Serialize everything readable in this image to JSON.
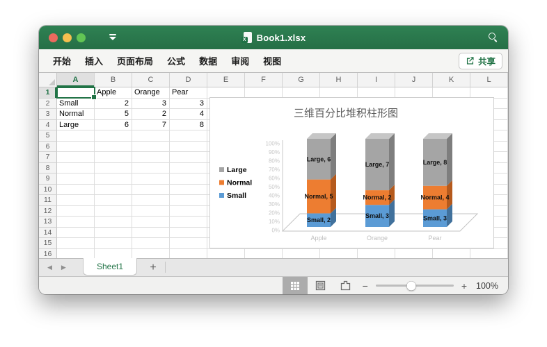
{
  "colors": {
    "accent_green": "#217346",
    "titlebar_green": "#2b7a4d",
    "series_small": "#5B9BD5",
    "series_normal": "#ED7D31",
    "series_large": "#A5A5A5"
  },
  "titlebar": {
    "title": "Book1.xlsx",
    "doc_badge": "X",
    "traffic_lights": [
      "close",
      "minimize",
      "zoom"
    ]
  },
  "menubar": {
    "items": [
      "开始",
      "插入",
      "页面布局",
      "公式",
      "数据",
      "审阅",
      "视图"
    ],
    "share_label": "共享"
  },
  "grid": {
    "column_headers": [
      "A",
      "B",
      "C",
      "D",
      "E",
      "F",
      "G",
      "H",
      "I",
      "J",
      "K",
      "L"
    ],
    "row_count": 16,
    "selected_cell": "A1",
    "selected_column": "A",
    "selected_row": "1",
    "cells": {
      "B1": "Apple",
      "C1": "Orange",
      "D1": "Pear",
      "A2": "Small",
      "B2": "2",
      "C2": "3",
      "D2": "3",
      "A3": "Normal",
      "B3": "5",
      "C3": "2",
      "D3": "4",
      "A4": "Large",
      "B4": "6",
      "C4": "7",
      "D4": "8"
    }
  },
  "sheet_tabs": {
    "active": "Sheet1",
    "add_label": "+",
    "back_arrow": "◀",
    "forward_arrow": "▶"
  },
  "status_bar": {
    "views": [
      "normal-view",
      "page-layout-view",
      "page-break-view"
    ],
    "active_view": "normal-view",
    "zoom_out": "−",
    "zoom_in": "+",
    "zoom_level": "100%"
  },
  "chart_data": {
    "type": "bar",
    "subtype": "3d-100-percent-stacked-column",
    "title": "三维百分比堆积柱形图",
    "categories": [
      "Apple",
      "Orange",
      "Pear"
    ],
    "series": [
      {
        "name": "Small",
        "values": [
          2,
          3,
          3
        ],
        "color": "#5B9BD5",
        "side_color": "#41719C"
      },
      {
        "name": "Normal",
        "values": [
          5,
          2,
          4
        ],
        "color": "#ED7D31",
        "side_color": "#B55A1D"
      },
      {
        "name": "Large",
        "values": [
          6,
          7,
          8
        ],
        "color": "#A5A5A5",
        "side_color": "#7E7E7E",
        "top_color": "#C6C6C6"
      }
    ],
    "stack_order": [
      "Small",
      "Normal",
      "Large"
    ],
    "legend": {
      "position": "left",
      "entries": [
        "Large",
        "Normal",
        "Small"
      ]
    },
    "y_axis": {
      "min": 0,
      "max": 1,
      "ticks": [
        "0%",
        "10%",
        "20%",
        "30%",
        "40%",
        "50%",
        "60%",
        "70%",
        "80%",
        "90%",
        "100%"
      ]
    },
    "data_labels_format": "{name}, {value}",
    "grid_on": false
  }
}
